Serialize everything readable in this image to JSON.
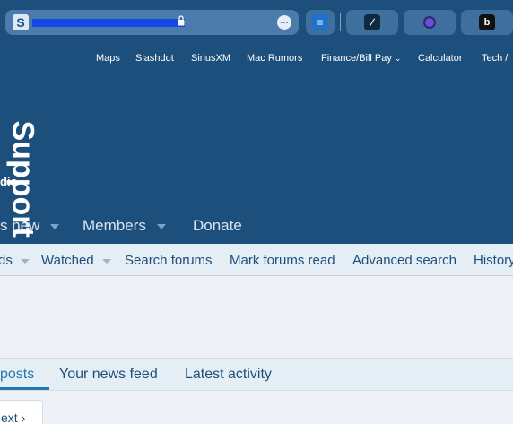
{
  "browser": {
    "site_icon_glyph": "S",
    "more_glyph": "…",
    "extensions": [
      {
        "name": "wifi-extension",
        "glyph": "≡"
      },
      {
        "name": "vector-extension",
        "glyph": "∕"
      },
      {
        "name": "circle-extension",
        "glyph": ""
      },
      {
        "name": "b-extension",
        "glyph": "b"
      }
    ]
  },
  "bookmarks": {
    "items": [
      "Maps",
      "Slashdot",
      "SiriusXM",
      "Mac Rumors",
      "Finance/Bill Pay",
      "Calculator",
      "Tech /"
    ]
  },
  "site": {
    "logo_text": "Support",
    "logo_sub": "dio"
  },
  "nav": {
    "items": [
      "s new",
      "Members",
      "Donate"
    ]
  },
  "subnav": {
    "items": [
      "ds",
      "Watched",
      "Search forums",
      "Mark forums read",
      "Advanced search",
      "History"
    ]
  },
  "tabs": {
    "items": [
      "posts",
      "Your news feed",
      "Latest activity"
    ]
  },
  "pager": {
    "next_label": "ext ›"
  },
  "colors": {
    "header_bg": "#1d4f7c",
    "accent": "#2577b1",
    "subnav_bg": "#e6eef5"
  }
}
